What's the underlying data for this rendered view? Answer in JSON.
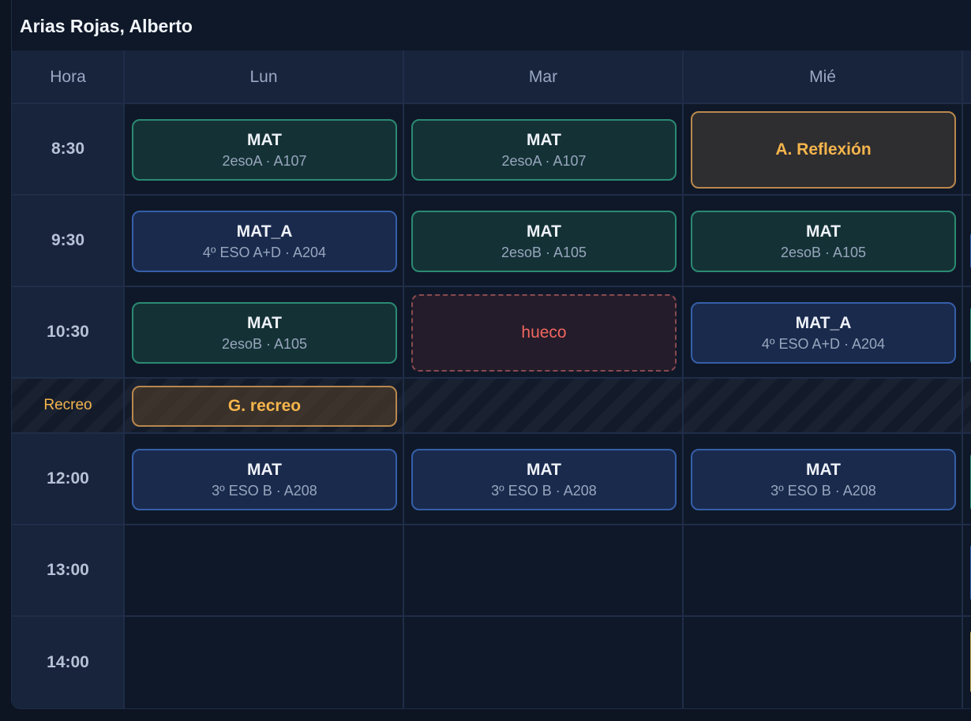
{
  "title": "Arias Rojas, Alberto",
  "headers": {
    "hora": "Hora",
    "days": [
      "Lun",
      "Mar",
      "Mié"
    ]
  },
  "times": [
    "8:30",
    "9:30",
    "10:30",
    "Recreo",
    "12:00",
    "13:00",
    "14:00"
  ],
  "slots": {
    "lun_0830": {
      "subject": "MAT",
      "info": "2esoA · A107"
    },
    "mar_0830": {
      "subject": "MAT",
      "info": "2esoA · A107"
    },
    "mie_0830": {
      "subject": "A. Reflexión"
    },
    "lun_0930": {
      "subject": "MAT_A",
      "info": "4º ESO A+D · A204"
    },
    "mar_0930": {
      "subject": "MAT",
      "info": "2esoB · A105"
    },
    "mie_0930": {
      "subject": "MAT",
      "info": "2esoB · A105"
    },
    "lun_1030": {
      "subject": "MAT",
      "info": "2esoB · A105"
    },
    "mar_1030": {
      "subject": "hueco"
    },
    "mie_1030": {
      "subject": "MAT_A",
      "info": "4º ESO A+D · A204"
    },
    "lun_recreo": {
      "subject": "G. recreo"
    },
    "lun_1200": {
      "subject": "MAT",
      "info": "3º ESO B · A208"
    },
    "mar_1200": {
      "subject": "MAT",
      "info": "3º ESO B · A208"
    },
    "mie_1200": {
      "subject": "MAT",
      "info": "3º ESO B · A208"
    }
  },
  "colors": {
    "teal_border": "#2b8a72",
    "blue_border": "#355fa8",
    "orange_border": "#b9884d",
    "accent_orange": "#f5b54c",
    "gap_red": "#f0665f"
  }
}
